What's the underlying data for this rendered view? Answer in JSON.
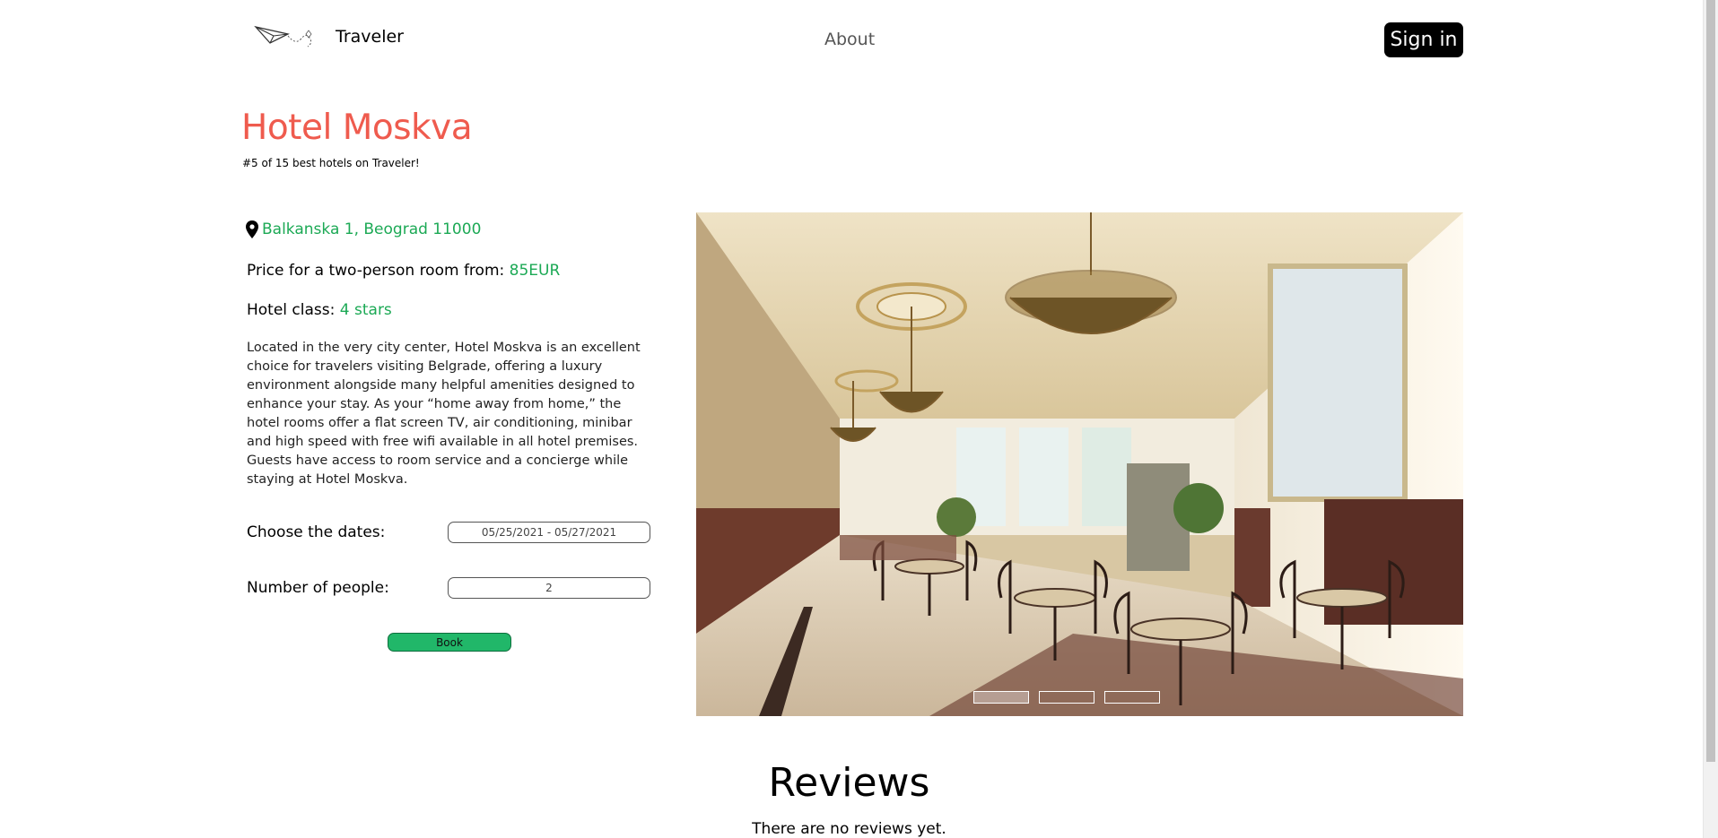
{
  "navbar": {
    "brand": "Traveler",
    "about": "About",
    "sign_in": "Sign in"
  },
  "hotel": {
    "name": "Hotel Moskva",
    "ranking": "#5 of 15 best hotels on Traveler!",
    "address": "Balkanska 1, Beograd 11000",
    "price_label": "Price for a two-person room from:",
    "price_value": "85EUR",
    "class_label": "Hotel class:",
    "class_value": "4 stars",
    "description": "Located in the very city center, Hotel Moskva is an excellent choice for travelers visiting Belgrade, offering a luxury environment alongside many helpful amenities designed to enhance your stay. As your “home away from home,” the hotel rooms offer a flat screen TV, air conditioning, minibar and high speed with free wifi available in all hotel premises. Guests have access to room service and a concierge while staying at Hotel Moskva."
  },
  "booking": {
    "dates_label": "Choose the dates:",
    "dates_value": "05/25/2021 - 05/27/2021",
    "people_label": "Number of people:",
    "people_value": "2",
    "book_label": "Book"
  },
  "carousel": {
    "slide_count": 3,
    "active_index": 0
  },
  "reviews": {
    "title": "Reviews",
    "empty_text": "There are no reviews yet."
  },
  "colors": {
    "title": "#ef5b4e",
    "accent_green": "#1ca955",
    "book_button": "#21b769",
    "sign_in_bg": "#000000"
  },
  "icons": [
    "paper-plane-logo-icon",
    "map-pin-icon"
  ]
}
